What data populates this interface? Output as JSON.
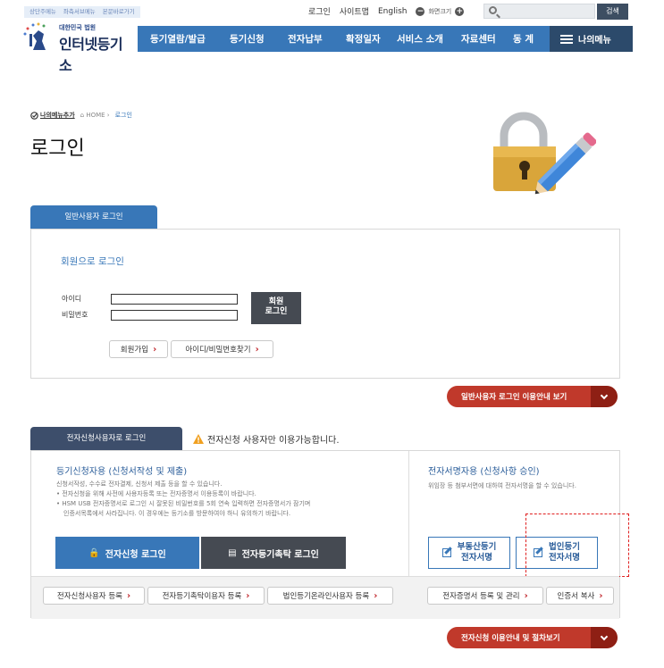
{
  "skip_links": [
    "상단주메뉴",
    "좌측서브메뉴",
    "본문바로가기"
  ],
  "util": {
    "login": "로그인",
    "sitemap": "사이트맵",
    "english": "English",
    "zoom_label": "화면크기",
    "zoom_out": "−",
    "zoom_in": "+",
    "search_placeholder": "",
    "search_button": "검색"
  },
  "logo": {
    "court": "대한민국 법원",
    "name": "인터넷등기소"
  },
  "nav": {
    "items": [
      "등기열람/발급",
      "등기신청",
      "전자납부",
      "확정일자",
      "서비스 소개",
      "자료센터",
      "동 계"
    ],
    "mymenu": "나의메뉴"
  },
  "breadcrumb": {
    "add": "나의메뉴추가",
    "home": "HOME",
    "current": "로그인"
  },
  "page_title": "로그인",
  "general": {
    "tab": "일반사용자 로그인",
    "heading": "회원으로 로그인",
    "id_label": "아이디",
    "pw_label": "비밀번호",
    "login_button_line1": "회원",
    "login_button_line2": "로그인",
    "signup": "회원가입",
    "find": "아이디/비밀번호찾기",
    "guide": "일반사용자 로그인 이용안내 보기"
  },
  "e_apply": {
    "tab": "전자신청사용자로 로그인",
    "notice": "전자신청 사용자만 이용가능합니다.",
    "left_heading": "등기신청자용 (신청서작성 및 제출)",
    "left_desc": [
      "신청서작성, 수수료 전자결제, 신청서 제출 등을 할 수 있습니다.",
      "• 전자신청을 위해 사전에 사용자등록 또는 전자증명서 이용등록이 바랍니다.",
      "• HSM USB 전자증명서로 로그인 시 잘못된 비밀번호를 5회 연속 입력하면 전자증명서가 잠기며",
      "인증서목록에서 사라집니다. 이 경우에는 등기소를 방문하여야 하니 유의하기 바랍니다."
    ],
    "apply_login": "전자신청 로그인",
    "trust_login": "전자등기촉탁 로그인",
    "right_heading": "전자서명자용 (신청사항 승인)",
    "right_desc": "위임장 등 첨부서면에 대하여 전자서명을 할 수 있습니다.",
    "realestate_sign_line1": "부동산등기",
    "realestate_sign_line2": "전자서명",
    "corp_sign_line1": "법인등기",
    "corp_sign_line2": "전자서명",
    "bottom_left": [
      "전자신청사용자 등록",
      "전자등기촉탁이용자 등록",
      "법인등기온라인사용자 등록"
    ],
    "bottom_right": [
      "전자증명서 등록 및 관리",
      "인증서 복사"
    ],
    "guide": "전자신청 이용안내 및 절차보기"
  },
  "colors": {
    "nav": "#3877b8",
    "red": "#c0392b",
    "dark": "#454a52"
  }
}
